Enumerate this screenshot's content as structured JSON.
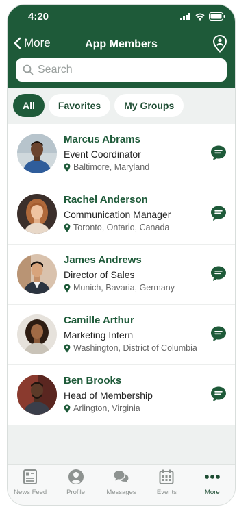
{
  "status_bar": {
    "time": "4:20"
  },
  "nav": {
    "back_label": "More",
    "title": "App Members"
  },
  "search": {
    "placeholder": "Search"
  },
  "filters": [
    {
      "label": "All",
      "active": true
    },
    {
      "label": "Favorites",
      "active": false
    },
    {
      "label": "My Groups",
      "active": false
    }
  ],
  "members": [
    {
      "name": "Marcus Abrams",
      "title": "Event Coordinator",
      "location": "Baltimore, Maryland"
    },
    {
      "name": "Rachel Anderson",
      "title": "Communication Manager",
      "location": "Toronto, Ontario, Canada"
    },
    {
      "name": "James Andrews",
      "title": "Director of Sales",
      "location": "Munich, Bavaria, Germany"
    },
    {
      "name": "Camille Arthur",
      "title": "Marketing Intern",
      "location": "Washington, District of Columbia"
    },
    {
      "name": "Ben Brooks",
      "title": "Head of Membership",
      "location": "Arlington, Virginia"
    }
  ],
  "tabs": [
    {
      "label": "News Feed",
      "icon": "news-feed-icon"
    },
    {
      "label": "Profile",
      "icon": "profile-icon"
    },
    {
      "label": "Messages",
      "icon": "messages-icon"
    },
    {
      "label": "Events",
      "icon": "events-icon"
    },
    {
      "label": "More",
      "icon": "more-icon",
      "active": true
    }
  ],
  "colors": {
    "brand": "#1e5a39",
    "background": "#eef1f0",
    "muted": "#8e9391"
  }
}
